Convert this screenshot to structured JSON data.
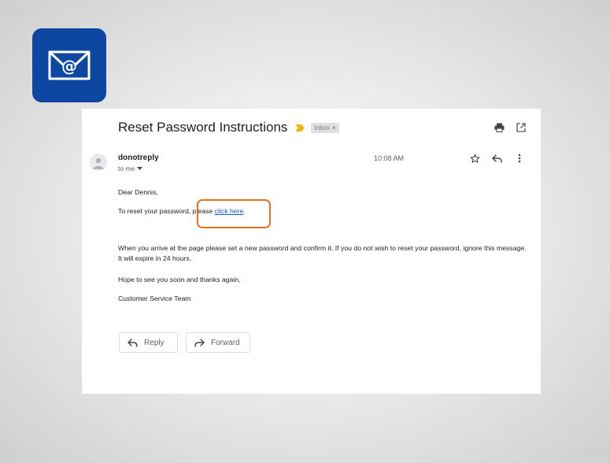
{
  "app_icon": {
    "name": "email-at-icon",
    "color": "#0d47a1"
  },
  "email": {
    "subject": "Reset Password Instructions",
    "label": "Inbox",
    "label_close": "×",
    "sender": "donotreply",
    "recipient": "to me",
    "time": "10:08 AM",
    "greeting": "Dear Dennis,",
    "line1_prefix": "To reset your password, please ",
    "line1_link": "click here",
    "line1_suffix": ".",
    "paragraph": "When you arrive at the page please set a new password and confirm it. If you do not wish to reset your password, ignore this message. It will expire in 24 hours.",
    "closing": "Hope to see you soon and thanks again,",
    "signature": "Customer Service Team"
  },
  "actions": {
    "reply_label": "Reply",
    "forward_label": "Forward"
  },
  "colors": {
    "highlight": "#e8731e",
    "link": "#1155cc",
    "importance": "#f4b400"
  }
}
